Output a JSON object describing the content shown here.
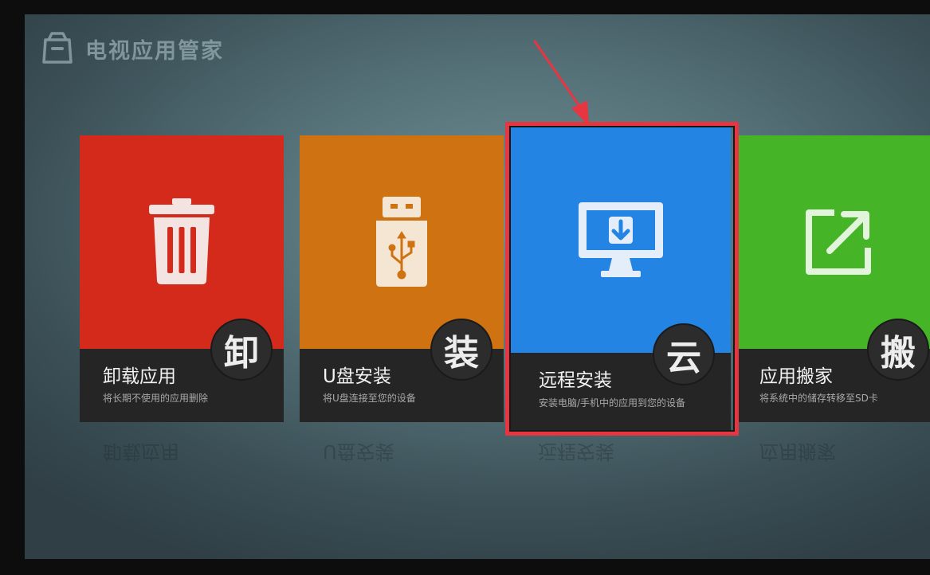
{
  "app": {
    "title": "电视应用管家",
    "logo_icon": "shopping-bag-icon"
  },
  "tiles": [
    {
      "title": "卸载应用",
      "subtitle": "将长期不使用的应用删除",
      "badge": "卸",
      "color": "#d32a1c",
      "icon": "trash-icon"
    },
    {
      "title": "U盘安装",
      "subtitle": "将U盘连接至您的设备",
      "badge": "装",
      "color": "#cf7211",
      "icon": "usb-drive-icon"
    },
    {
      "title": "远程安装",
      "subtitle": "安装电脑/手机中的应用到您的设备",
      "badge": "云",
      "color": "#2484e3",
      "icon": "monitor-download-icon",
      "focused": true
    },
    {
      "title": "应用搬家",
      "subtitle": "将系统中的储存转移至SD卡",
      "badge": "搬",
      "color": "#45b426",
      "icon": "external-link-icon"
    }
  ],
  "highlight": {
    "color": "#e53642",
    "pointer": "red-arrow-annotation"
  }
}
